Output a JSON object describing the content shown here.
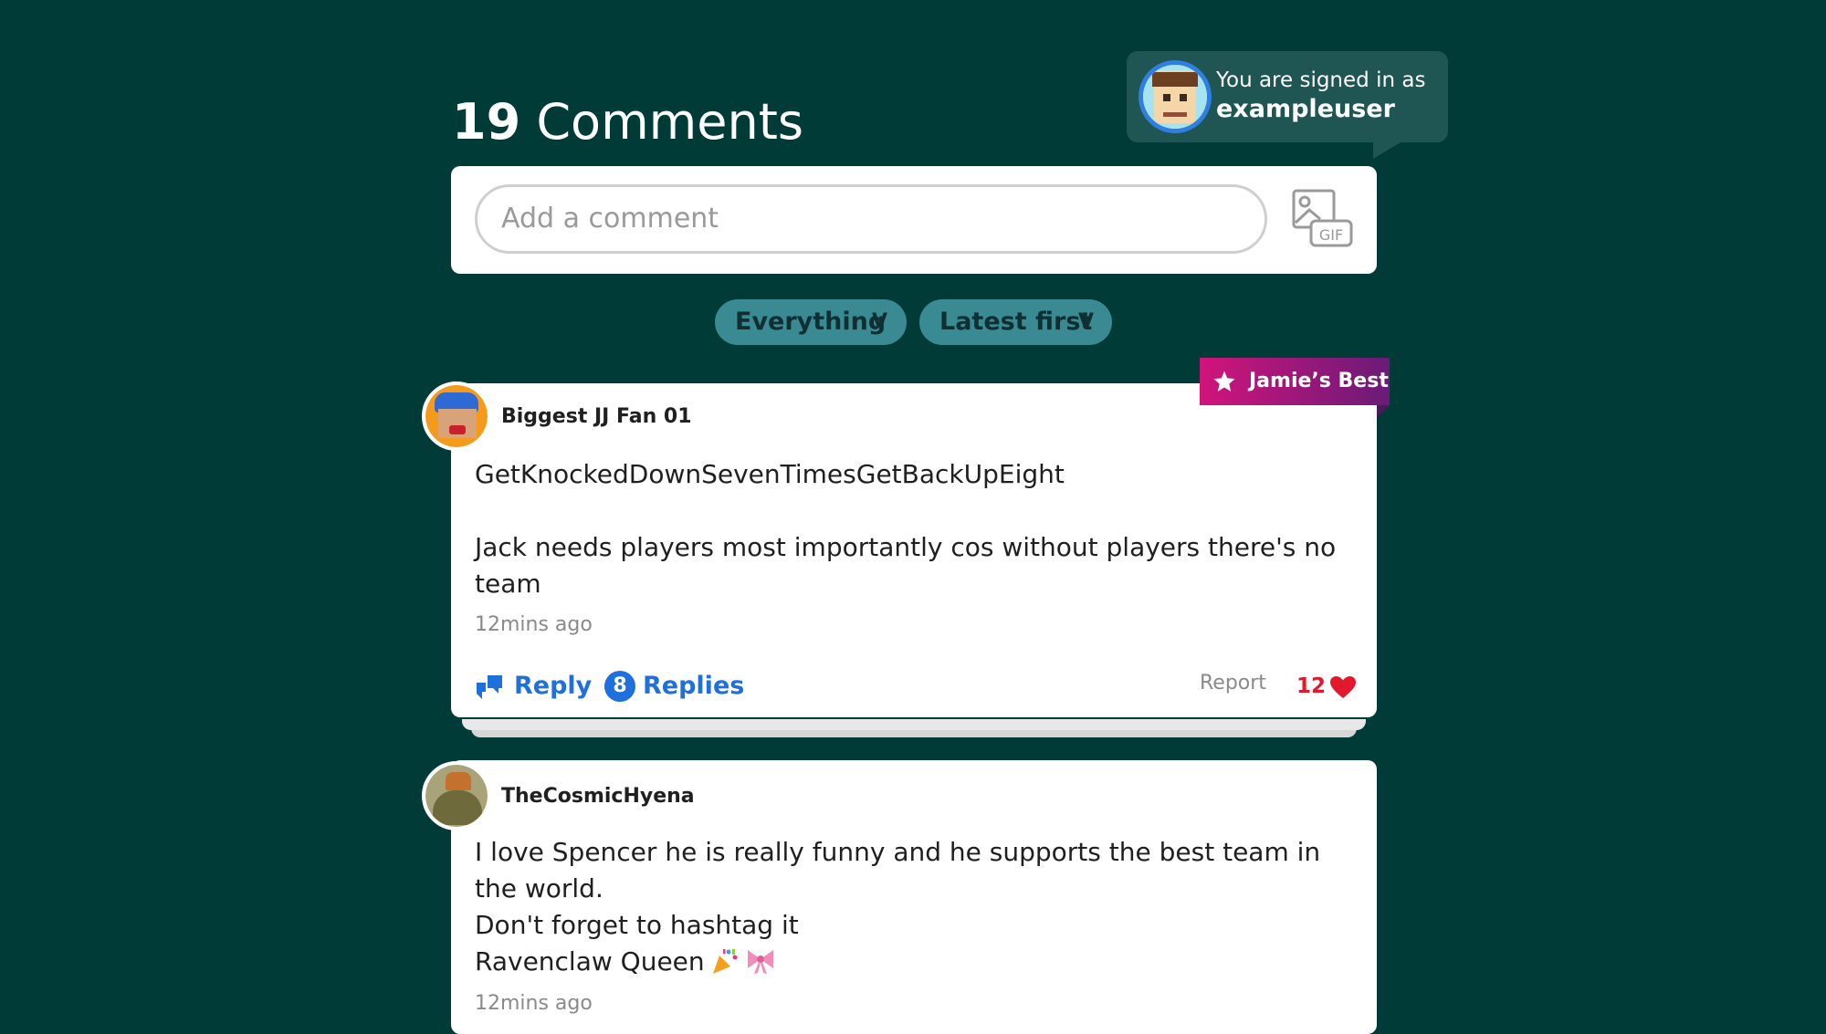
{
  "header": {
    "count": "19",
    "label": "Comments"
  },
  "signed_in": {
    "line1": "You are signed in as",
    "username": "exampleuser"
  },
  "composer": {
    "placeholder": "Add a comment",
    "gif_label": "GIF"
  },
  "filters": [
    {
      "label": "Everything",
      "chevron": "V"
    },
    {
      "label": "Latest first",
      "chevron": "V"
    }
  ],
  "comments": [
    {
      "username": "Biggest JJ Fan 01",
      "badge": "Jamie’s Best",
      "body_line1": "GetKnockedDownSevenTimesGetBackUpEight",
      "body_line2": "Jack needs players most importantly cos without players there's no team",
      "timestamp": "12mins ago",
      "reply_label": "Reply",
      "replies_count": "8",
      "replies_label": "Replies",
      "report_label": "Report",
      "likes": "12"
    },
    {
      "username": "TheCosmicHyena",
      "body": "I love Spencer he is really funny and he supports the best team in the world.\nDon't forget to hashtag it\nRavenclaw Queen",
      "emojis": [
        "party-popper-emoji",
        "ribbon-emoji"
      ],
      "timestamp": "12mins ago"
    }
  ],
  "colors": {
    "background": "#003b38",
    "accent_blue": "#1f6fdc",
    "like_red": "#e2192d",
    "pill": "#3a8a93",
    "badge_start": "#d1147b",
    "badge_end": "#6a1b78"
  }
}
